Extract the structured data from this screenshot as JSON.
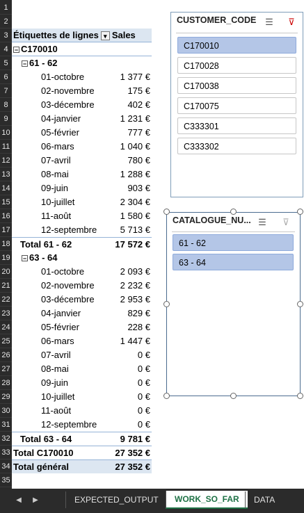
{
  "pivot": {
    "header": {
      "label": "Étiquettes de lignes",
      "value_header": "Sales"
    },
    "customer": "C170010",
    "group1": {
      "label": "61 - 62",
      "months": [
        {
          "m": "01-octobre",
          "v": "1 377 €"
        },
        {
          "m": "02-novembre",
          "v": "175 €"
        },
        {
          "m": "03-décembre",
          "v": "402 €"
        },
        {
          "m": "04-janvier",
          "v": "1 231 €"
        },
        {
          "m": "05-février",
          "v": "777 €"
        },
        {
          "m": "06-mars",
          "v": "1 040 €"
        },
        {
          "m": "07-avril",
          "v": "780 €"
        },
        {
          "m": "08-mai",
          "v": "1 288 €"
        },
        {
          "m": "09-juin",
          "v": "903 €"
        },
        {
          "m": "10-juillet",
          "v": "2 304 €"
        },
        {
          "m": "11-août",
          "v": "1 580 €"
        },
        {
          "m": "12-septembre",
          "v": "5 713 €"
        }
      ],
      "total_label": "Total 61 - 62",
      "total_value": "17 572 €"
    },
    "group2": {
      "label": "63 - 64",
      "months": [
        {
          "m": "01-octobre",
          "v": "2 093 €"
        },
        {
          "m": "02-novembre",
          "v": "2 232 €"
        },
        {
          "m": "03-décembre",
          "v": "2 953 €"
        },
        {
          "m": "04-janvier",
          "v": "829 €"
        },
        {
          "m": "05-février",
          "v": "228 €"
        },
        {
          "m": "06-mars",
          "v": "1 447 €"
        },
        {
          "m": "07-avril",
          "v": "0 €"
        },
        {
          "m": "08-mai",
          "v": "0 €"
        },
        {
          "m": "09-juin",
          "v": "0 €"
        },
        {
          "m": "10-juillet",
          "v": "0 €"
        },
        {
          "m": "11-août",
          "v": "0 €"
        },
        {
          "m": "12-septembre",
          "v": "0 €"
        }
      ],
      "total_label": "Total 63 - 64",
      "total_value": "9 781 €"
    },
    "customer_total_label": "Total C170010",
    "customer_total_value": "27 352 €",
    "grand_total_label": "Total général",
    "grand_total_value": "27 352 €"
  },
  "row_numbers": [
    "1",
    "2",
    "3",
    "4",
    "5",
    "6",
    "7",
    "8",
    "9",
    "10",
    "11",
    "12",
    "13",
    "14",
    "15",
    "16",
    "17",
    "18",
    "19",
    "20",
    "21",
    "22",
    "23",
    "24",
    "25",
    "26",
    "27",
    "28",
    "29",
    "30",
    "31",
    "32",
    "33",
    "34",
    "35"
  ],
  "slicer_customer": {
    "title": "CUSTOMER_CODE",
    "items": [
      "C170010",
      "C170028",
      "C170038",
      "C170075",
      "C333301",
      "C333302"
    ],
    "selected": "C170010"
  },
  "slicer_catalogue": {
    "title": "CATALOGUE_NU...",
    "items": [
      "61 - 62",
      "63 - 64"
    ]
  },
  "tabs": [
    "EXPECTED_OUTPUT",
    "WORK_SO_FAR",
    "DATA"
  ],
  "active_tab": "WORK_SO_FAR",
  "icons": {
    "multiselect": "multi-select-icon",
    "clearfilter": "clear-filter-icon",
    "prev": "left-arrow-icon",
    "next": "right-arrow-icon"
  }
}
